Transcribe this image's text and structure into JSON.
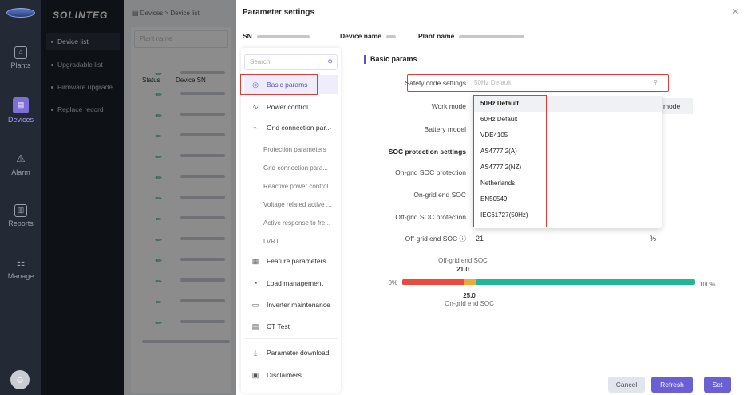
{
  "rail": {
    "items": [
      {
        "label": "Plants",
        "icon": "plant-icon"
      },
      {
        "label": "Devices",
        "icon": "device-icon"
      },
      {
        "label": "Alarm",
        "icon": "alarm-icon"
      },
      {
        "label": "Reports",
        "icon": "report-icon"
      },
      {
        "label": "Manage",
        "icon": "manage-icon"
      }
    ],
    "active": "Devices",
    "accent": "#7d6fd6"
  },
  "brand": "SOLINTEG",
  "submenu": {
    "items": [
      "Device list",
      "Upgradable list",
      "Firmware upgrade",
      "Replace record"
    ],
    "active": "Device list"
  },
  "background_page": {
    "breadcrumb": [
      "Devices",
      "Device list"
    ],
    "search_placeholder": "Plant name",
    "columns": [
      "Status",
      "Device SN"
    ]
  },
  "drawer": {
    "title": "Parameter settings",
    "info": {
      "sn_label": "SN",
      "device_name_label": "Device name",
      "plant_name_label": "Plant name"
    },
    "nav": {
      "search_placeholder": "Search",
      "items": [
        {
          "label": "Basic params",
          "icon": "basic-params-icon"
        },
        {
          "label": "Power control",
          "icon": "power-control-icon"
        },
        {
          "label": "Grid connection par...",
          "icon": "grid-connection-icon"
        },
        {
          "label": "Feature parameters",
          "icon": "feature-parameters-icon"
        },
        {
          "label": "Load management",
          "icon": "load-management-icon"
        },
        {
          "label": "Inverter maintenance",
          "icon": "inverter-maintenance-icon"
        },
        {
          "label": "CT Test",
          "icon": "ct-test-icon"
        },
        {
          "label": "Parameter download",
          "icon": "download-icon"
        },
        {
          "label": "Disclaimers",
          "icon": "disclaimers-icon"
        }
      ],
      "subitems": [
        "Protection parameters",
        "Grid connection para...",
        "Reactive power control",
        "Voltage related active ...",
        "Active response to fre...",
        "LVRT"
      ],
      "selected": "Basic params"
    },
    "section_title": "Basic params",
    "fields": {
      "safety_code_label": "Safety code settings",
      "safety_code_value": "50Hz Default",
      "work_mode_label": "Work mode",
      "work_mode_value": "id mode",
      "battery_model_label": "Battery model",
      "soc_protection_label": "SOC protection settings",
      "on_grid_soc_protection_label": "On-grid SOC protection",
      "on_grid_end_soc_label": "On-grid end SOC",
      "off_grid_soc_protection_label": "Off-grid SOC protection",
      "off_grid_end_soc_label": "Off-grid end SOC ⓘ",
      "off_grid_end_soc_value": "21",
      "percent_unit": "%"
    },
    "dropdown": {
      "options": [
        "50Hz Default",
        "60Hz Default",
        "VDE4105",
        "AS4777.2(A)",
        "AS4777.2(NZ)",
        "Netherlands",
        "EN50549",
        "IEC61727(50Hz)"
      ],
      "selected": "50Hz Default"
    },
    "soc_bar": {
      "off_grid_label": "Off-grid end SOC",
      "off_grid_value": "21.0",
      "on_grid_label": "On-grid end SOC",
      "on_grid_value": "25.0",
      "min_label": "0%",
      "max_label": "100%",
      "off_grid_fraction": 0.21,
      "on_grid_fraction": 0.25,
      "colors": {
        "low": "#f0483e",
        "mid": "#f7a53a",
        "high": "#1db894"
      }
    },
    "buttons": {
      "cancel": "Cancel",
      "refresh": "Refresh",
      "set": "Set"
    }
  }
}
